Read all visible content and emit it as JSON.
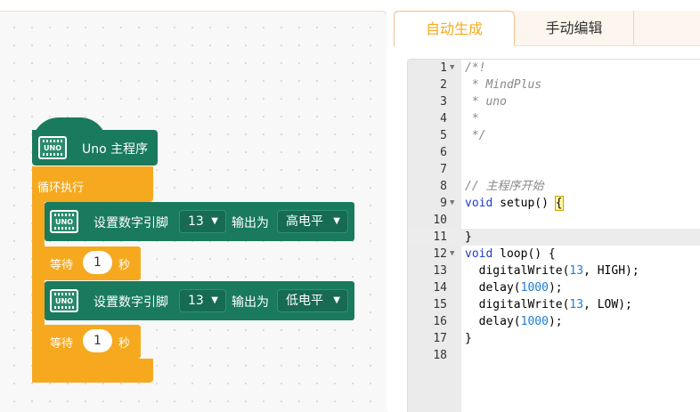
{
  "workspace": {
    "hat_block": {
      "label": "Uno 主程序",
      "icon_text": "UNO"
    },
    "loop_block": {
      "label": "循环执行"
    },
    "statements": [
      {
        "label": "设置数字引脚",
        "pin": "13",
        "mid_label": "输出为",
        "level": "高电平",
        "icon_text": "UNO"
      },
      {
        "wait_label": "等待",
        "value": "1",
        "unit": "秒"
      },
      {
        "label": "设置数字引脚",
        "pin": "13",
        "mid_label": "输出为",
        "level": "低电平",
        "icon_text": "UNO"
      },
      {
        "wait_label": "等待",
        "value": "1",
        "unit": "秒"
      }
    ]
  },
  "tabs": {
    "auto": "自动生成",
    "manual": "手动编辑"
  },
  "code": {
    "lines": [
      {
        "num": "1",
        "text": "/*!"
      },
      {
        "num": "2",
        "text": " * MindPlus"
      },
      {
        "num": "3",
        "text": " * uno"
      },
      {
        "num": "4",
        "text": " *"
      },
      {
        "num": "5",
        "text": " */"
      },
      {
        "num": "6",
        "text": ""
      },
      {
        "num": "7",
        "text": ""
      },
      {
        "num": "8",
        "text": "// 主程序开始"
      },
      {
        "num": "9",
        "text": "void setup() {"
      },
      {
        "num": "10",
        "text": ""
      },
      {
        "num": "11",
        "text": "}"
      },
      {
        "num": "12",
        "text": "void loop() {"
      },
      {
        "num": "13",
        "text": "  digitalWrite(13, HIGH);"
      },
      {
        "num": "14",
        "text": "  delay(1000);"
      },
      {
        "num": "15",
        "text": "  digitalWrite(13, LOW);"
      },
      {
        "num": "16",
        "text": "  delay(1000);"
      },
      {
        "num": "17",
        "text": "}"
      },
      {
        "num": "18",
        "text": ""
      }
    ]
  },
  "colors": {
    "block_green": "#1a7a5e",
    "block_orange": "#f6a91f",
    "tab_active": "#f6a91f",
    "keyword": "#1f3cc4",
    "number": "#1e7cd6",
    "comment": "#888888"
  }
}
